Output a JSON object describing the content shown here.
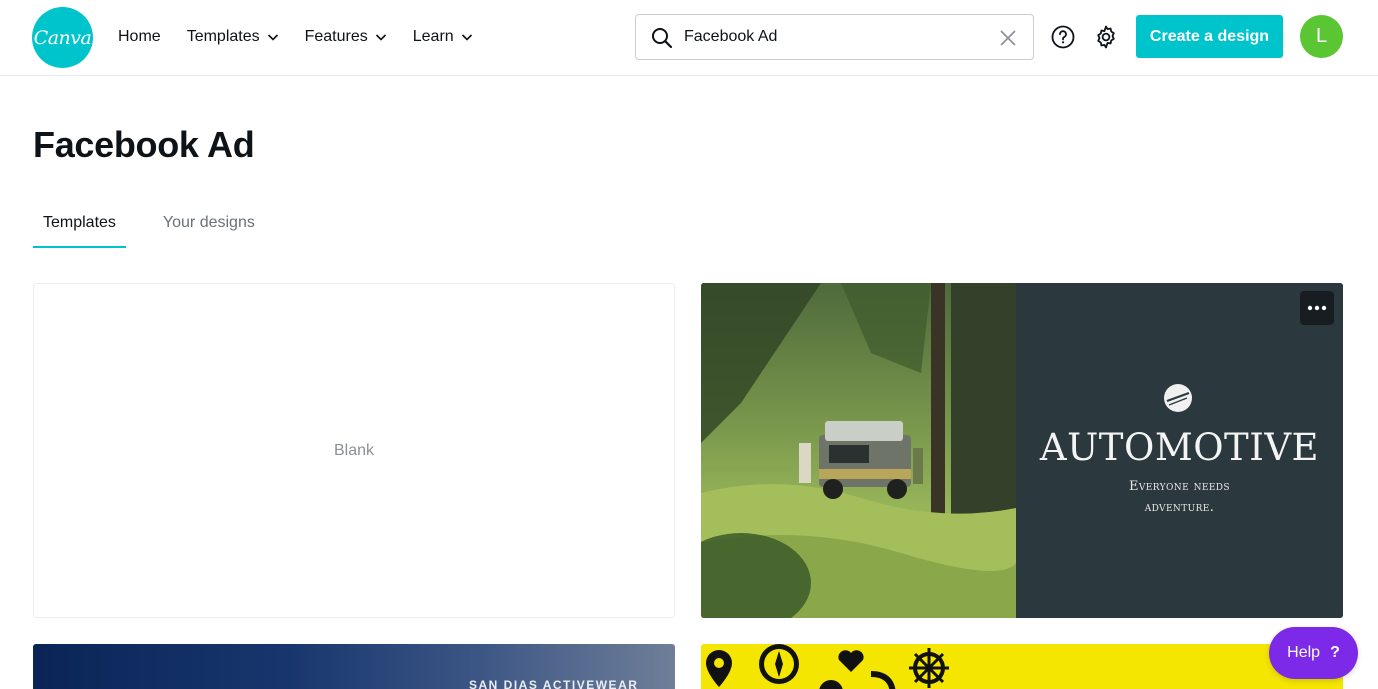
{
  "header": {
    "logo_text": "Canva",
    "nav": [
      {
        "label": "Home",
        "has_dropdown": false
      },
      {
        "label": "Templates",
        "has_dropdown": true
      },
      {
        "label": "Features",
        "has_dropdown": true
      },
      {
        "label": "Learn",
        "has_dropdown": true
      }
    ],
    "search": {
      "value": "Facebook Ad",
      "icon": "search-icon",
      "clear_icon": "close-icon"
    },
    "help_icon": "help-circle-icon",
    "settings_icon": "gear-icon",
    "create_button": "Create a design",
    "avatar_initial": "L"
  },
  "page": {
    "title": "Facebook Ad",
    "tabs": [
      {
        "label": "Templates",
        "active": true
      },
      {
        "label": "Your designs",
        "active": false
      }
    ]
  },
  "templates": {
    "blank": {
      "label": "Blank"
    },
    "automotive": {
      "title": "AUTOMOTIVE",
      "subtitle_line1": "Everyone needs",
      "subtitle_line2": "adventure.",
      "menu_icon": "more-horizontal-icon"
    },
    "activewear": {
      "label": "SAN DIAS ACTIVEWEAR"
    },
    "icons_card": {
      "icons": [
        "map-pin-icon",
        "compass-icon",
        "heart-icon",
        "gear-icon",
        "arrow-icon",
        "ship-wheel-icon"
      ]
    }
  },
  "help_fab": {
    "label": "Help",
    "symbol": "?"
  },
  "colors": {
    "brand_teal": "#00c4cc",
    "avatar_green": "#5ac633",
    "help_purple": "#7d2ae8",
    "auto_panel": "#2b383e",
    "yellow": "#f4e600"
  }
}
